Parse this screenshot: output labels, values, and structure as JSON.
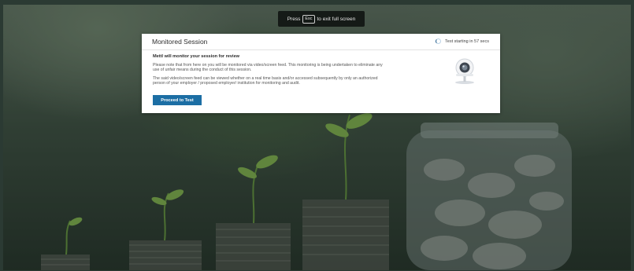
{
  "banner": {
    "prefix": "Press",
    "key": "Esc",
    "suffix": "to exit full screen"
  },
  "dialog": {
    "title": "Monitored Session",
    "timer_text": "Test starting in 57 secs",
    "subheading": "Mettl will monitor your session for review",
    "paragraph1": "Please note that from here on you will be monitored via video/screen feed. This monitoring is being undertaken to eliminate any use of unfair means during the conduct of this session.",
    "paragraph2": "The said video/screen feed can be viewed whether on a real time basis and/or accessed subsequently by only an authorized person of your employer / proposed employer/ institution for monitoring and audit.",
    "proceed_label": "Proceed to Test",
    "illustration_icon": "webcam-icon"
  },
  "colors": {
    "primary_button": "#1c6ea4",
    "spinner_accent": "#1f5a8a",
    "dialog_bg": "#ffffff",
    "banner_bg": "#151a17"
  }
}
